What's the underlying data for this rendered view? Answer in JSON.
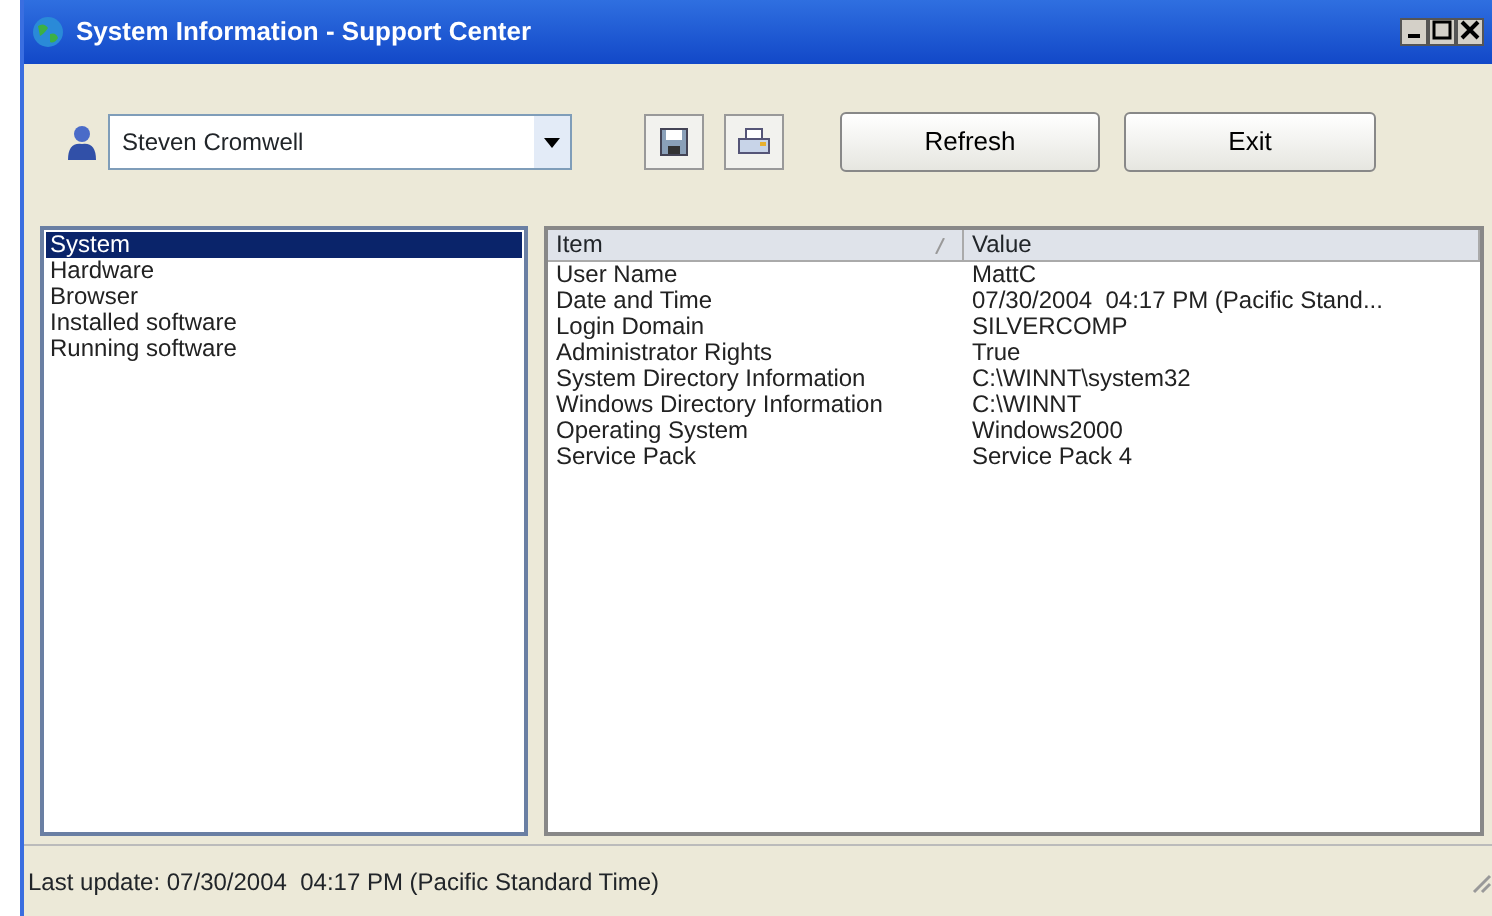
{
  "window": {
    "title": "System Information - Support Center"
  },
  "toolbar": {
    "user": "Steven Cromwell",
    "buttons": [
      "Refresh",
      "Exit"
    ]
  },
  "categories": [
    {
      "label": "System",
      "selected": true
    },
    {
      "label": "Hardware",
      "selected": false
    },
    {
      "label": "Browser",
      "selected": false
    },
    {
      "label": "Installed software",
      "selected": false
    },
    {
      "label": "Running software",
      "selected": false
    }
  ],
  "table": {
    "columns": [
      "Item",
      "Value"
    ],
    "rows": [
      [
        "User Name",
        "MattC"
      ],
      [
        "Date and Time",
        "07/30/2004  04:17 PM (Pacific Stand..."
      ],
      [
        "Login Domain",
        "SILVERCOMP"
      ],
      [
        "Administrator Rights",
        "True"
      ],
      [
        "System Directory Information",
        "C:\\WINNT\\system32"
      ],
      [
        "Windows Directory Information",
        "C:\\WINNT"
      ],
      [
        "Operating System",
        "Windows2000"
      ],
      [
        "Service Pack",
        "Service Pack 4"
      ]
    ]
  },
  "status_bar": "Last update: 07/30/2004  04:17 PM (Pacific Standard Time)"
}
